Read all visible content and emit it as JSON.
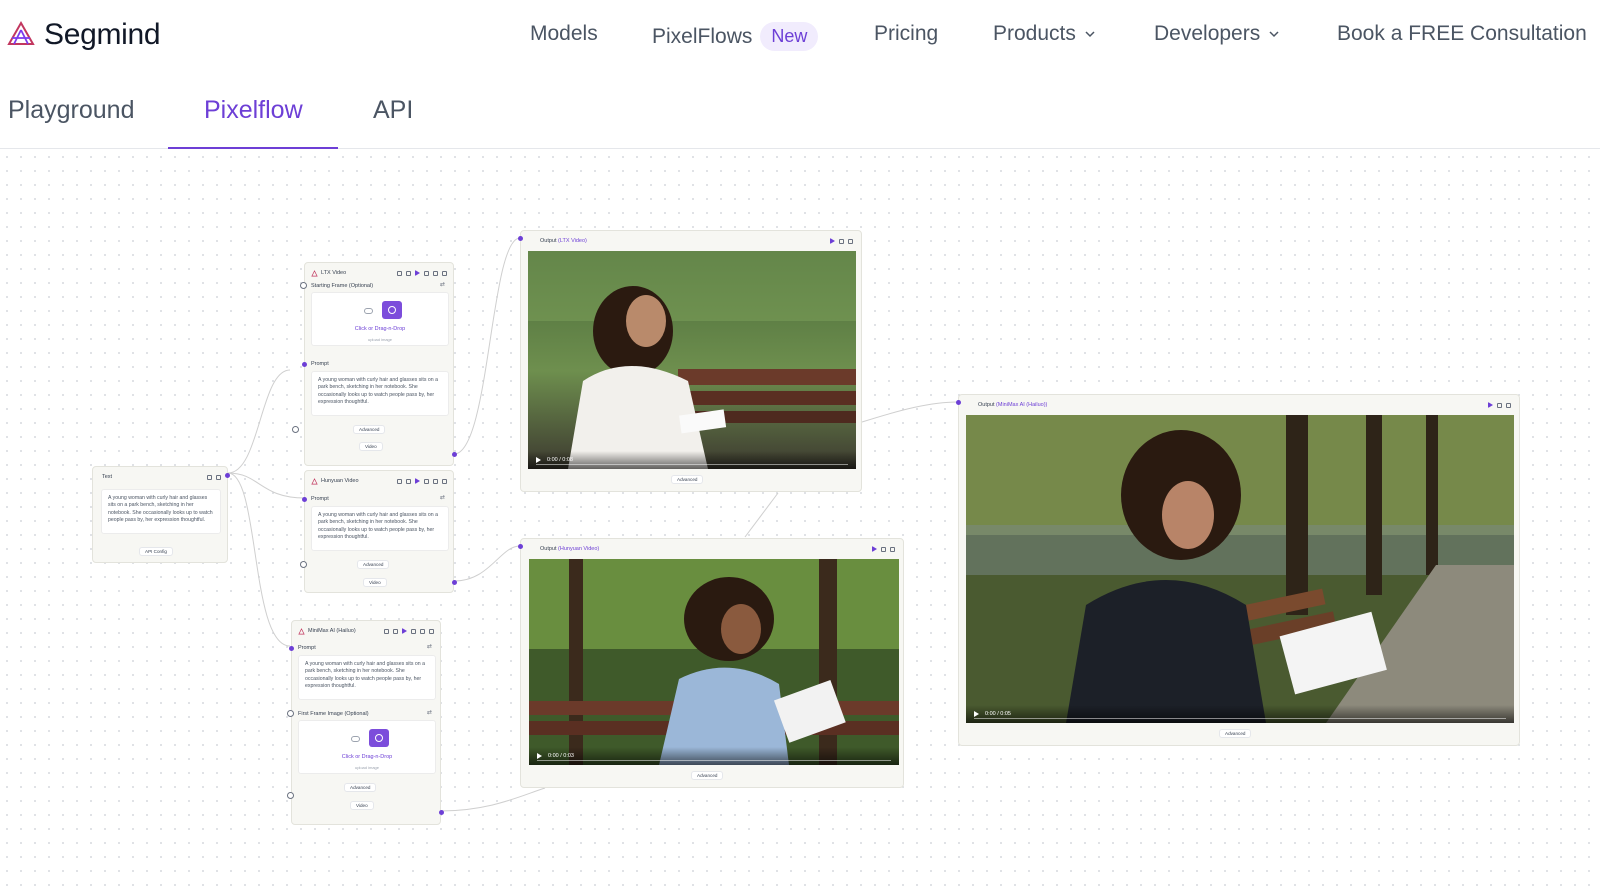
{
  "brand": {
    "name": "Segmind",
    "accent": "#6d3fd6"
  },
  "nav": {
    "models": "Models",
    "pixelflows": "PixelFlows",
    "new_badge": "New",
    "pricing": "Pricing",
    "products": "Products",
    "developers": "Developers",
    "consult": "Book a FREE Consultation"
  },
  "tabs": {
    "playground": "Playground",
    "pixelflow": "Pixelflow",
    "api": "API"
  },
  "nodes": {
    "text": {
      "title": "Text",
      "body": "A young woman with curly hair and glasses sits on a park bench, sketching in her notebook. She occasionally looks up to watch people pass by, her expression thoughtful.",
      "config": "API Config"
    },
    "ltx": {
      "title": "LTX Video",
      "starting_frame": "Starting Frame (Optional)",
      "upload_label": "Click or Drag-n-Drop",
      "upload_sub": "upload image",
      "prompt_label": "Prompt",
      "prompt": "A young woman with curly hair and glasses sits on a park bench, sketching in her notebook. She occasionally looks up to watch people pass by, her expression thoughtful.",
      "advanced": "Advanced",
      "video": "Video"
    },
    "hunyuan": {
      "title": "Hunyuan Video",
      "prompt_label": "Prompt",
      "prompt": "A young woman with curly hair and glasses sits on a park bench, sketching in her notebook. She occasionally looks up to watch people pass by, her expression thoughtful.",
      "advanced": "Advanced",
      "video": "Video"
    },
    "minimax": {
      "title": "MiniMax AI (Hailuo)",
      "prompt_label": "Prompt",
      "prompt": "A young woman with curly hair and glasses sits on a park bench, sketching in her notebook. She occasionally looks up to watch people pass by, her expression thoughtful.",
      "first_frame": "First Frame Image (Optional)",
      "upload_label": "Click or Drag-n-Drop",
      "upload_sub": "upload image",
      "advanced": "Advanced",
      "video": "Video"
    }
  },
  "outputs": {
    "ltx": {
      "label": "Output",
      "model": "(LTX Video)",
      "time": "0:00 / 0:08",
      "advanced": "Advanced"
    },
    "hunyuan": {
      "label": "Output",
      "model": "(Hunyuan Video)",
      "time": "0:00 / 0:03",
      "advanced": "Advanced"
    },
    "minimax": {
      "label": "Output",
      "model": "(MiniMax AI (Hailuo))",
      "time": "0:00 / 0:05",
      "advanced": "Advanced"
    }
  }
}
